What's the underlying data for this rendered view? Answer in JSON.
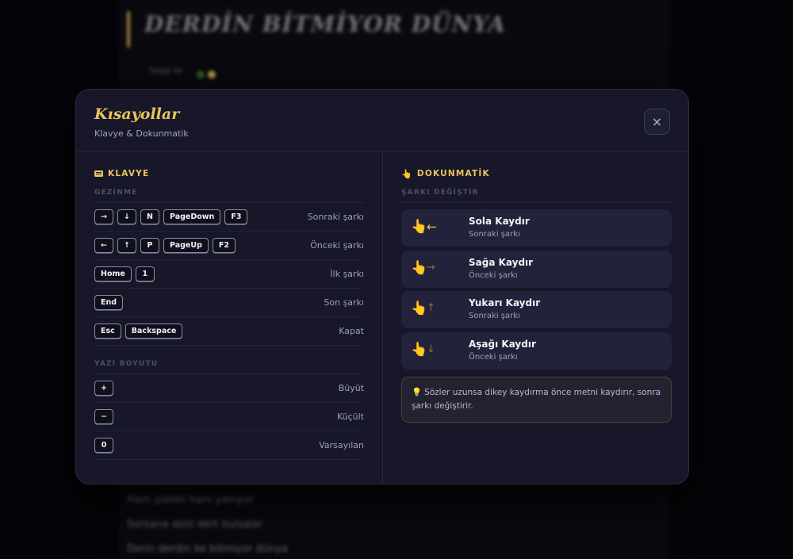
{
  "background": {
    "song_title": "DERDİN BİTMİYOR DÜNYA",
    "meta": "Saygı ile",
    "lyric_lines": [
      "Ham şiddet ham yanıyor",
      "Sorsana dost dert bulsalar",
      "Derin derdin ke bitmiyor dünya"
    ],
    "dot_colors": [
      "#3a6b2a",
      "#d9b548"
    ]
  },
  "modal": {
    "title": "Kısayollar",
    "subtitle": "Klavye & Dokunmatik",
    "close_icon": "×"
  },
  "keyboard": {
    "heading": "KLAVYE",
    "navigation": {
      "subhead": "GEZİNME",
      "rows": [
        {
          "keys": [
            "→",
            "↓",
            "N",
            "PageDown",
            "F3"
          ],
          "label": "Sonraki şarkı"
        },
        {
          "keys": [
            "←",
            "↑",
            "P",
            "PageUp",
            "F2"
          ],
          "label": "Önceki şarkı"
        },
        {
          "keys": [
            "Home",
            "1"
          ],
          "label": "İlk şarkı"
        },
        {
          "keys": [
            "End"
          ],
          "label": "Son şarkı"
        },
        {
          "keys": [
            "Esc",
            "Backspace"
          ],
          "label": "Kapat"
        }
      ]
    },
    "font_size": {
      "subhead": "YAZI BOYUTU",
      "rows": [
        {
          "keys": [
            "+"
          ],
          "label": "Büyüt"
        },
        {
          "keys": [
            "−"
          ],
          "label": "Küçült"
        },
        {
          "keys": [
            "0"
          ],
          "label": "Varsayılan"
        }
      ]
    }
  },
  "touch": {
    "heading": "DOKUNMATİK",
    "subhead": "ŞARKI DEĞİŞTİR",
    "hand_icon": "👆",
    "gestures": [
      {
        "arrow": "←",
        "title": "Sola Kaydır",
        "sub": "Sonraki şarkı",
        "strong": true
      },
      {
        "arrow": "→",
        "title": "Sağa Kaydır",
        "sub": "Önceki şarkı",
        "strong": false
      },
      {
        "arrow": "↑",
        "title": "Yukarı Kaydır",
        "sub": "Sonraki şarkı",
        "strong": false
      },
      {
        "arrow": "↓",
        "title": "Aşağı Kaydır",
        "sub": "Önceki şarkı",
        "strong": false
      }
    ],
    "tip_icon": "💡",
    "tip": "Sözler uzunsa dikey kaydırma önce metni kaydırır, sonra şarkı değiştirir."
  },
  "colors": {
    "accent": "#e9c45a",
    "modal_bg": "#171729",
    "card_bg": "#22223a"
  }
}
